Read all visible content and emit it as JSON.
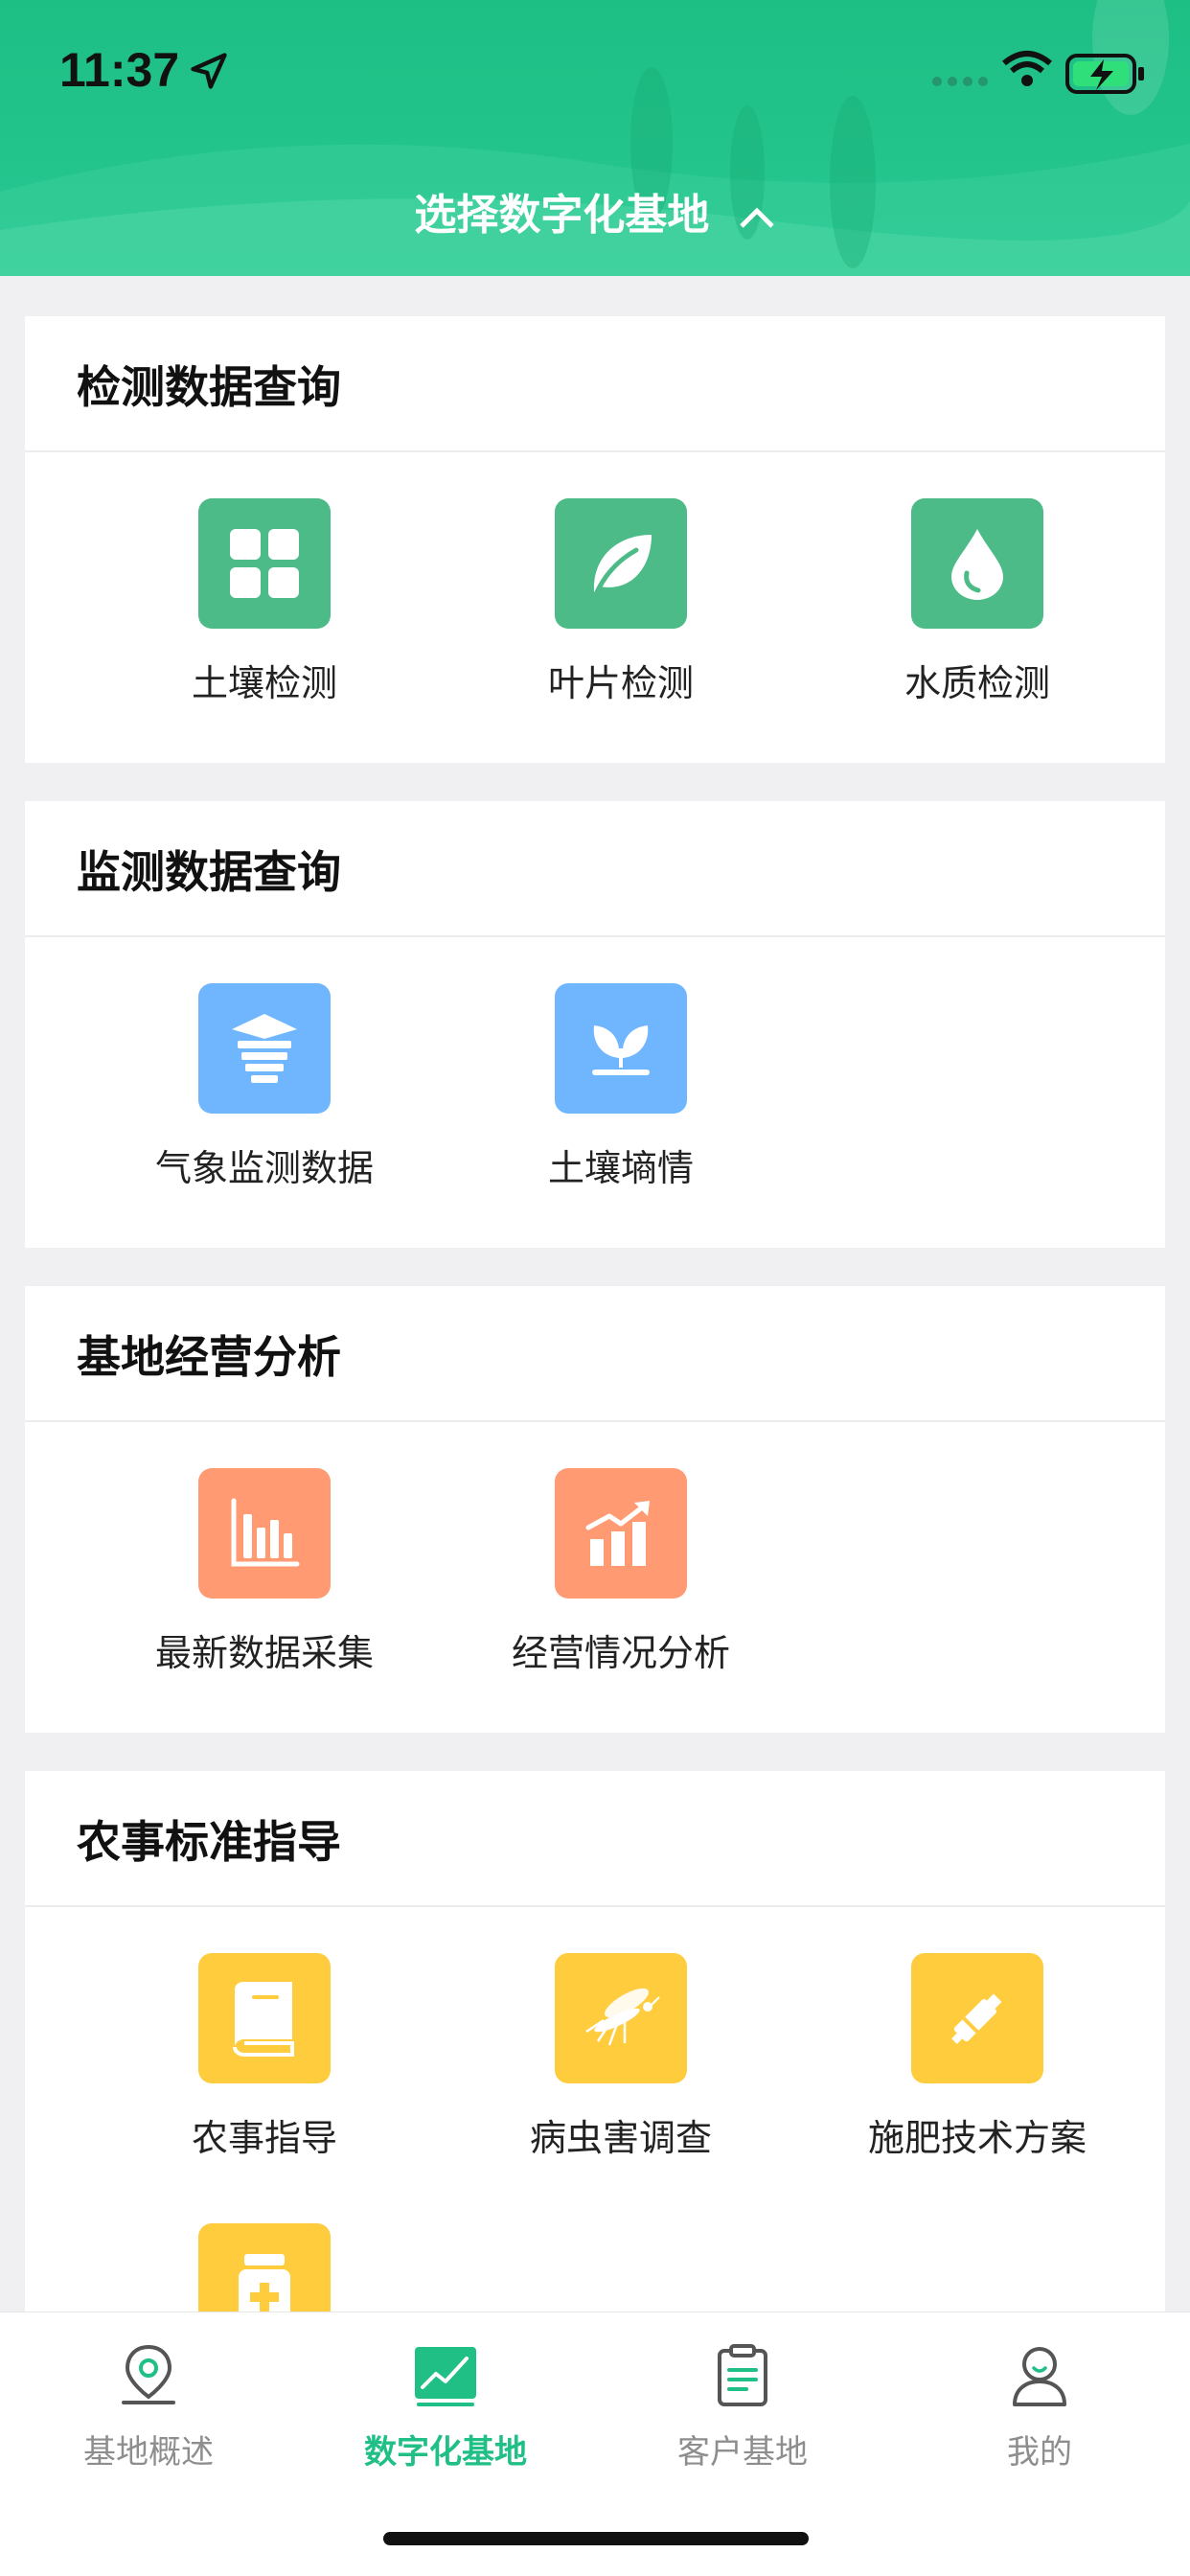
{
  "status_bar": {
    "time": "11:37"
  },
  "header": {
    "title": "选择数字化基地"
  },
  "sections": [
    {
      "title": "检测数据查询",
      "items": [
        {
          "label": "土壤检测",
          "icon": "grid-icon"
        },
        {
          "label": "叶片检测",
          "icon": "leaf-icon"
        },
        {
          "label": "水质检测",
          "icon": "water-drop-icon"
        }
      ]
    },
    {
      "title": "监测数据查询",
      "items": [
        {
          "label": "气象监测数据",
          "icon": "weather-station-icon"
        },
        {
          "label": "土壤墒情",
          "icon": "sprout-icon"
        }
      ]
    },
    {
      "title": "基地经营分析",
      "items": [
        {
          "label": "最新数据采集",
          "icon": "bar-chart-icon"
        },
        {
          "label": "经营情况分析",
          "icon": "trend-chart-icon"
        }
      ]
    },
    {
      "title": "农事标准指导",
      "items": [
        {
          "label": "农事指导",
          "icon": "book-icon"
        },
        {
          "label": "病虫害调查",
          "icon": "mosquito-icon"
        },
        {
          "label": "施肥技术方案",
          "icon": "syringe-icon"
        },
        {
          "label": "",
          "icon": "medicine-bottle-icon"
        }
      ]
    }
  ],
  "tabbar": {
    "items": [
      {
        "label": "基地概述",
        "icon": "location-pin-icon"
      },
      {
        "label": "数字化基地",
        "icon": "line-chart-icon",
        "active": true
      },
      {
        "label": "客户基地",
        "icon": "clipboard-icon"
      },
      {
        "label": "我的",
        "icon": "user-icon"
      }
    ]
  },
  "colors": {
    "brand_green": "#1fbf85",
    "detect_icon_bg": "#4cbb87",
    "monitor_icon_bg": "#70b6ff",
    "analysis_icon_bg": "#ff9a72",
    "guide_icon_bg": "#ffcc3e"
  }
}
